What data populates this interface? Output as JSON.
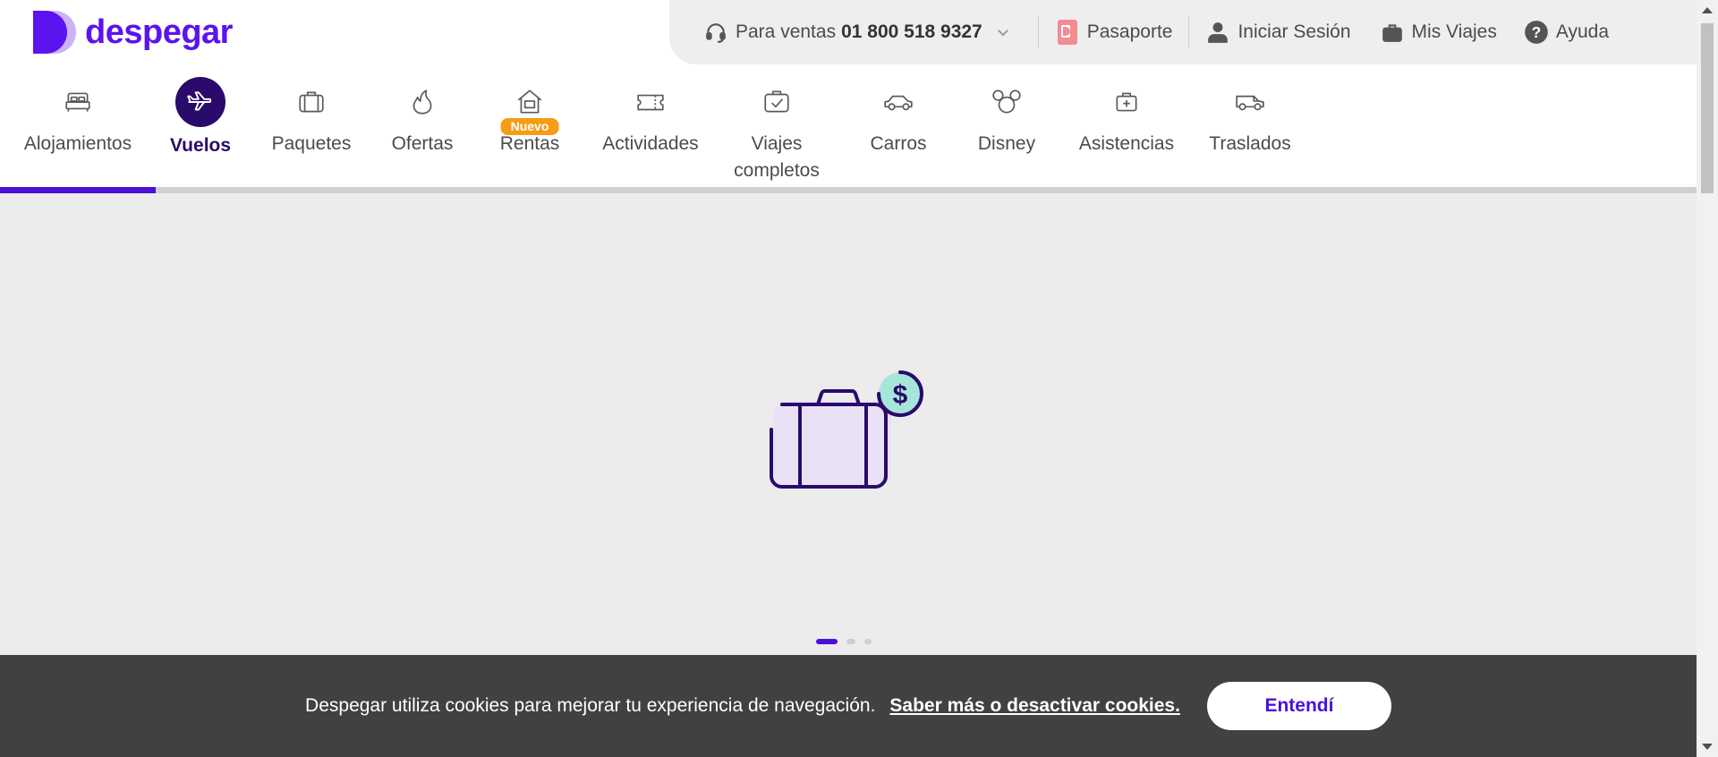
{
  "brand": {
    "name": "despegar",
    "color": "#5b13f0"
  },
  "topbar": {
    "sales_label": "Para ventas",
    "sales_phone": "01 800 518 9327",
    "passport": "Pasaporte",
    "login": "Iniciar Sesión",
    "my_trips": "Mis Viajes",
    "help": "Ayuda"
  },
  "nav": {
    "items": [
      {
        "label": "Alojamientos",
        "icon": "bed-icon"
      },
      {
        "label": "Vuelos",
        "icon": "airplane-icon",
        "active": true
      },
      {
        "label": "Paquetes",
        "icon": "suitcase-icon"
      },
      {
        "label": "Ofertas",
        "icon": "flame-icon"
      },
      {
        "label": "Rentas",
        "icon": "house-icon",
        "badge": "Nuevo"
      },
      {
        "label": "Actividades",
        "icon": "ticket-icon"
      },
      {
        "label": "Viajes completos",
        "icon": "calendar-check-icon"
      },
      {
        "label": "Carros",
        "icon": "car-icon"
      },
      {
        "label": "Disney",
        "icon": "mickey-icon"
      },
      {
        "label": "Asistencias",
        "icon": "medical-kit-icon"
      },
      {
        "label": "Traslados",
        "icon": "van-icon"
      }
    ]
  },
  "loader": {
    "icon": "suitcase-dollar-icon",
    "active_dot": 0,
    "dot_count": 3
  },
  "cookie": {
    "text": "Despegar utiliza cookies para mejorar tu experiencia de navegación.",
    "link": "Saber más o desactivar cookies.",
    "button": "Entendí"
  },
  "colors": {
    "accent": "#4a10d9",
    "active_nav": "#2a0a6b",
    "badge": "#f59d16",
    "cookie_bg": "#414141"
  }
}
